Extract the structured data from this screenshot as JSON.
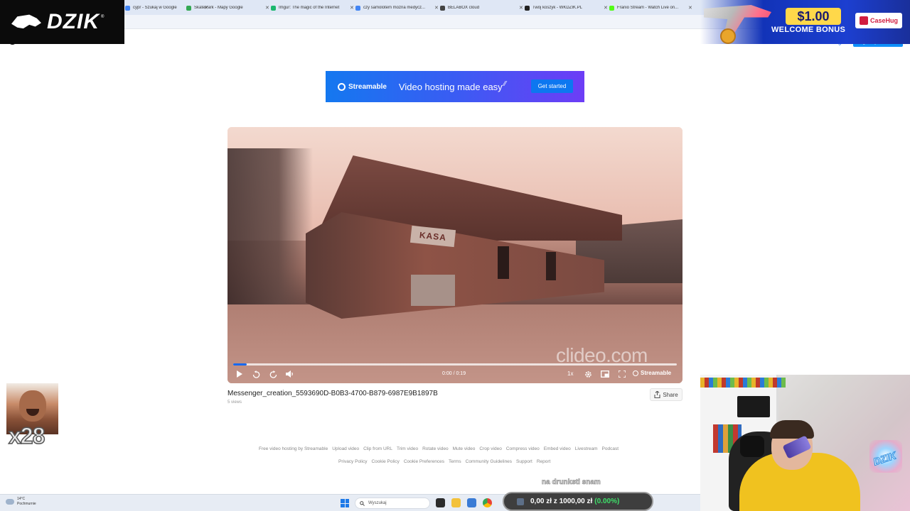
{
  "browser": {
    "tabs": [
      {
        "title": "cypr - Szukaj w Google",
        "color": "#4285f4"
      },
      {
        "title": "SkatePark - Mapy Google",
        "color": "#34a853"
      },
      {
        "title": "Imgur: The magic of the Internet",
        "color": "#1bb76e"
      },
      {
        "title": "czy samolotem mozna medycz...",
        "color": "#4285f4"
      },
      {
        "title": "BELABOX cloud",
        "color": "#444444"
      },
      {
        "title": "Twój koszyk - WKDZIK.PL",
        "color": "#222222"
      },
      {
        "title": "Franio Stream - Watch Live on...",
        "color": "#53fc18"
      }
    ]
  },
  "site": {
    "login_label": "Log in",
    "signup_label": "Sign up for free"
  },
  "banner": {
    "brand": "Streamable",
    "tagline": "Video hosting made easy",
    "cta": "Get started"
  },
  "player": {
    "scene_sign": "KASA",
    "watermark": "clideo.com",
    "time": "0:00 / 0:19",
    "speed": "1x",
    "brand": "Streamable",
    "progress": 0.03,
    "accent": "#1769f0"
  },
  "video": {
    "title": "Messenger_creation_5593690D-B0B3-4700-B879-6987E9B1897B",
    "views": "5 views",
    "share_label": "Share"
  },
  "footer": {
    "links_row1": [
      "Free video hosting by Streamable",
      "Upload video",
      "Clip from URL",
      "Trim video",
      "Rotate video",
      "Mute video",
      "Crop video",
      "Compress video",
      "Embed video",
      "Livestream",
      "Podcast"
    ],
    "links_row2": [
      "Privacy Policy",
      "Cookie Policy",
      "Cookie Preferences",
      "Terms",
      "Community Guidelines",
      "Support",
      "Report"
    ]
  },
  "taskbar": {
    "weather_temp": "14°C",
    "weather_desc": "Pochmurnie",
    "search_placeholder": "Wyszukaj"
  },
  "overlays": {
    "dzik_logo": "DZIK",
    "case_amount": "$1.00",
    "case_bonus": "WELCOME BONUS",
    "case_brand": "CaseHug",
    "meme_multiplier": "x28",
    "donate_text": "na drunksti snam",
    "counter_text": "0,00 zł z 1000,00 zł",
    "counter_pct": "(0.00%)",
    "cam_neon": "DZIK"
  }
}
